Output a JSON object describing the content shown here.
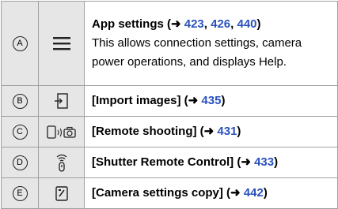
{
  "rows": [
    {
      "letter": "A",
      "icon": "hamburger-menu-icon",
      "title_pre": "App settings (➜ ",
      "refs": [
        "423",
        "426",
        "440"
      ],
      "sep": ", ",
      "title_post": ")",
      "body": "This allows connection settings, camera power operations, and displays Help."
    },
    {
      "letter": "B",
      "icon": "import-images-icon",
      "title_pre": "[Import images] (➜ ",
      "ref": "435",
      "title_post": ")"
    },
    {
      "letter": "C",
      "icon": "remote-shooting-icon",
      "title_pre": "[Remote shooting] (➜ ",
      "ref": "431",
      "title_post": ")"
    },
    {
      "letter": "D",
      "icon": "shutter-remote-icon",
      "title_pre": "[Shutter Remote Control] (➜ ",
      "ref": "433",
      "title_post": ")"
    },
    {
      "letter": "E",
      "icon": "settings-copy-icon",
      "title_pre": "[Camera settings copy] (➜ ",
      "ref": "442",
      "title_post": ")"
    }
  ],
  "colors": {
    "cell_bg": "#e6e6e6",
    "border": "#a0a0a0",
    "link": "#2a52be"
  }
}
